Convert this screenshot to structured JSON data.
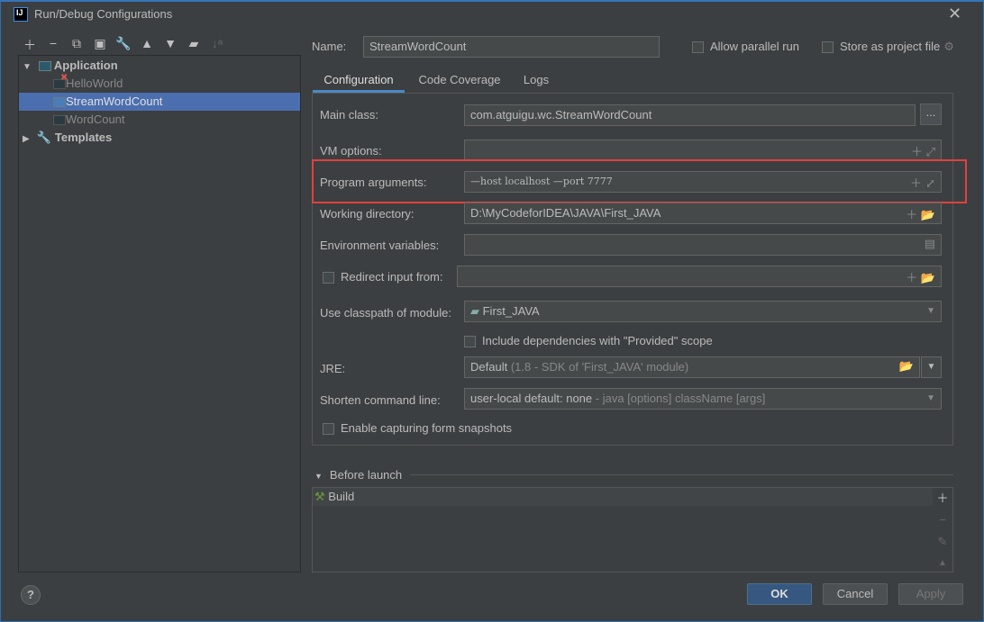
{
  "window": {
    "title": "Run/Debug Configurations",
    "logo": "IJ"
  },
  "toolbar": {
    "icons": [
      "plus-icon",
      "minus-icon",
      "copy-icon",
      "save-icon",
      "wrench-icon",
      "arrow-up-icon",
      "arrow-down-icon",
      "new-folder-icon",
      "sort-icon"
    ]
  },
  "tree": {
    "application": "Application",
    "items": [
      {
        "label": "HelloWorld",
        "error": true
      },
      {
        "label": "StreamWordCount",
        "selected": true
      },
      {
        "label": "WordCount"
      }
    ],
    "templates": "Templates"
  },
  "header": {
    "name_label": "Name:",
    "name_value": "StreamWordCount",
    "allow_parallel": "Allow parallel run",
    "store_project": "Store as project file"
  },
  "tabs": [
    {
      "label": "Configuration",
      "active": true
    },
    {
      "label": "Code Coverage"
    },
    {
      "label": "Logs"
    }
  ],
  "form": {
    "main_class_label": "Main class:",
    "main_class": "com.atguigu.wc.StreamWordCount",
    "browse": "...",
    "vm_label": "VM options:",
    "vm_value": "",
    "args_label": "Program arguments:",
    "args_value": "—host localhost —port 7777",
    "wd_label": "Working directory:",
    "wd_value": "D:\\MyCodeforIDEA\\JAVA\\First_JAVA",
    "env_label": "Environment variables:",
    "env_value": "",
    "redirect_label": "Redirect input from:",
    "redirect_value": "",
    "module_label": "Use classpath of module:",
    "module_value": "First_JAVA",
    "include_deps": "Include dependencies with \"Provided\" scope",
    "jre_label": "JRE:",
    "jre_value": "Default",
    "jre_hint": "(1.8 - SDK of 'First_JAVA' module)",
    "shorten_label": "Shorten command line:",
    "shorten_value": "user-local default: none",
    "shorten_hint": "- java [options] className [args]",
    "snapshots": "Enable capturing form snapshots"
  },
  "before_launch": {
    "title": "Before launch",
    "items": [
      "Build"
    ]
  },
  "buttons": {
    "ok": "OK",
    "cancel": "Cancel",
    "apply": "Apply",
    "help": "?"
  },
  "colors": {
    "background": "#3c3f41",
    "selection": "#4b6eaf",
    "highlight_box": "#e0413f",
    "ok_button": "#365880"
  }
}
